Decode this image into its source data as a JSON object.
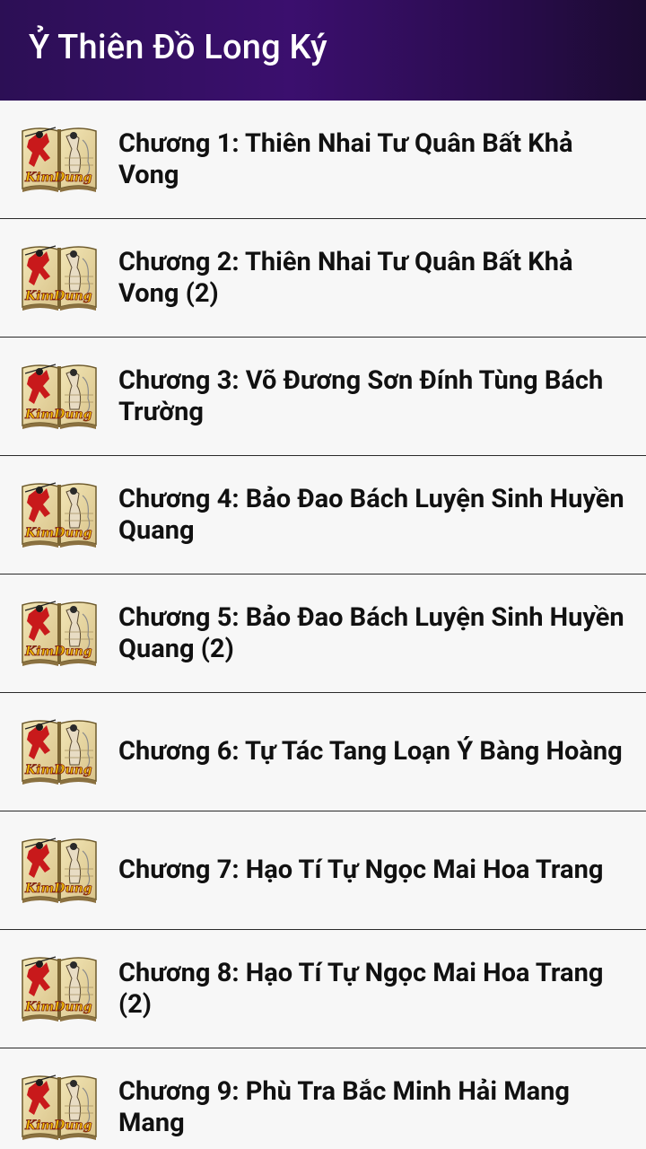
{
  "app_bar": {
    "title": "Ỷ Thiên Đồ Long Ký"
  },
  "chapters": [
    {
      "title": "Chương 1: Thiên Nhai Tư Quân Bất Khả Vong"
    },
    {
      "title": "Chương 2: Thiên Nhai Tư Quân Bất Khả Vong (2)"
    },
    {
      "title": "Chương 3: Võ Đương Sơn Đính Tùng Bách Trường"
    },
    {
      "title": "Chương 4: Bảo Đao Bách Luyện Sinh Huyền Quang"
    },
    {
      "title": "Chương 5: Bảo Đao Bách Luyện Sinh Huyền Quang (2)"
    },
    {
      "title": "Chương 6: Tự Tác Tang Loạn Ý Bàng Hoàng"
    },
    {
      "title": "Chương 7: Hạo Tí Tự Ngọc Mai Hoa Trang"
    },
    {
      "title": "Chương 8: Hạo Tí Tự Ngọc Mai Hoa Trang (2)"
    },
    {
      "title": "Chương 9: Phù Tra Bắc Minh Hải Mang Mang"
    }
  ],
  "thumbnail": {
    "icon": "kim-dung-book-icon",
    "logo_text": "KimDung"
  },
  "colors": {
    "app_bar_start": "#2c0f55",
    "app_bar_end": "#1c0b32",
    "background": "#f7f7f7",
    "divider": "#2a2a2a",
    "text": "#111111"
  }
}
